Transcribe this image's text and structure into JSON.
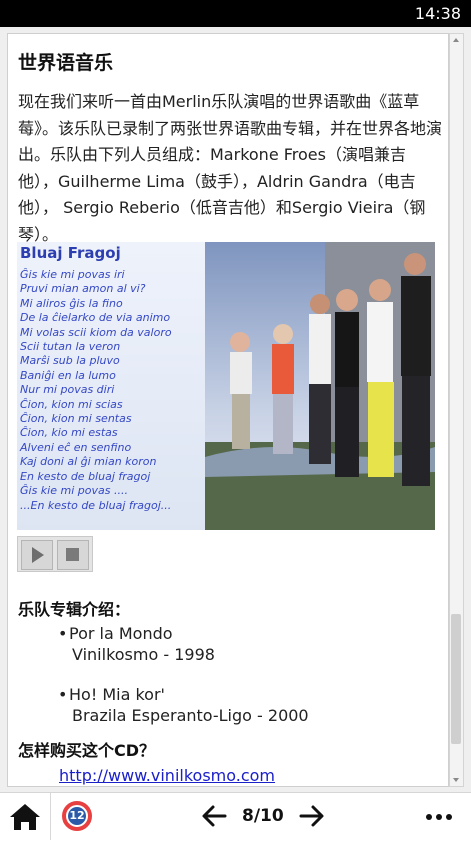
{
  "status_bar": {
    "time": "14:38"
  },
  "article": {
    "title": "世界语音乐",
    "intro": "现在我们来听一首由Merlin乐队演唱的世界语歌曲《蓝草莓》。该乐队已录制了两张世界语歌曲专辑，并在世界各地演出。乐队由下列人员组成：Markone Froes（演唱兼吉他），Guilherme Lima（鼓手），Aldrin Gandra（电吉他）， Sergio Reberio（低音吉他）和Sergio Vieira（钢琴）。",
    "lyrics_title": "Bluaj Fragoj",
    "lyrics_lines": [
      "Ĝis kie mi povas iri",
      "Pruvi mian amon al vi?",
      "Mi aliros ĝis la fino",
      "De la ĉielarko de via animo",
      "Mi volas scii kiom da valoro",
      "Scii tutan la veron",
      "Marŝi sub la pluvo",
      "Baniĝi en la lumo",
      "Nur mi povas diri",
      "Ĉion, kion mi scias",
      "Ĉion, kion mi sentas",
      "Ĉion, kio mi estas",
      "Alveni eĉ en senfino",
      "Kaj doni al ĝi mian koron",
      "En kesto de bluaj fragoj",
      "Ĝis kie mi povas ....",
      "...En kesto de bluaj fragoj..."
    ],
    "albums_heading": "乐队专辑介绍：",
    "albums": [
      {
        "bullet": "•",
        "name": "Por la Mondo",
        "label": "Vinilkosmo - 1998"
      },
      {
        "bullet": "•",
        "name": "Ho! Mia kor'",
        "label": "Brazila Esperanto-Ligo - 2000"
      }
    ],
    "buy_heading": "怎样购买这个CD？",
    "buy_link": "http://www.vinilkosmo.com"
  },
  "nav": {
    "badge_number": "12",
    "page_indicator": "8/10"
  },
  "colors": {
    "link": "#1b20c8",
    "lyrics_text": "#3548c4",
    "badge_ring": "#e84040",
    "badge_fill": "#2a5aa8"
  },
  "icons": [
    "home-icon",
    "badge-icon",
    "arrow-left-icon",
    "arrow-right-icon",
    "more-icon",
    "play-icon",
    "stop-icon"
  ]
}
